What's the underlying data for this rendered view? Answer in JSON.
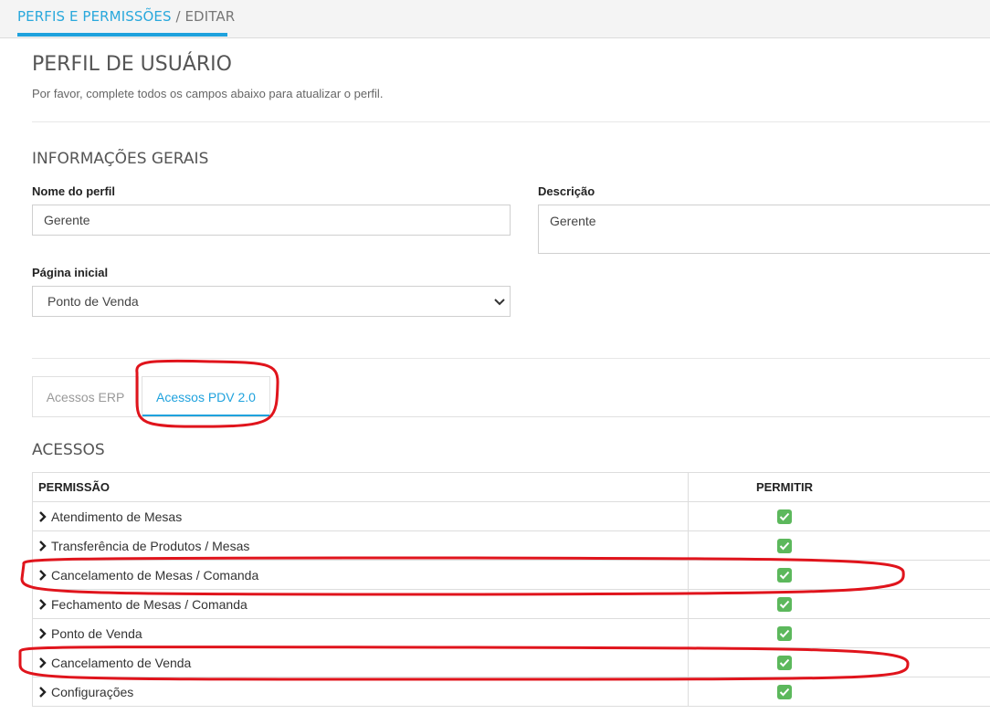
{
  "breadcrumb": {
    "link": "PERFIS E PERMISSÕES",
    "separator": " / ",
    "current": "EDITAR"
  },
  "page": {
    "title": "PERFIL DE USUÁRIO",
    "subtitle": "Por favor, complete todos os campos abaixo para atualizar o perfil."
  },
  "general": {
    "title": "INFORMAÇÕES GERAIS",
    "name_label": "Nome do perfil",
    "name_value": "Gerente",
    "description_label": "Descrição",
    "description_value": "Gerente",
    "home_label": "Página inicial",
    "home_value": "Ponto de Venda"
  },
  "tabs": [
    {
      "label": "Acessos ERP",
      "active": false
    },
    {
      "label": "Acessos PDV 2.0",
      "active": true
    }
  ],
  "access": {
    "title": "ACESSOS",
    "columns": [
      "PERMISSÃO",
      "PERMITIR"
    ],
    "rows": [
      {
        "label": "Atendimento de Mesas",
        "allowed": true
      },
      {
        "label": "Transferência de Produtos / Mesas",
        "allowed": true
      },
      {
        "label": "Cancelamento de Mesas / Comanda",
        "allowed": true
      },
      {
        "label": "Fechamento de Mesas / Comanda",
        "allowed": true
      },
      {
        "label": "Ponto de Venda",
        "allowed": true
      },
      {
        "label": "Cancelamento de Venda",
        "allowed": true
      },
      {
        "label": "Configurações",
        "allowed": true
      }
    ]
  },
  "colors": {
    "accent": "#1fa2dd",
    "check": "#5cb85c",
    "annotation": "#e0141c"
  }
}
